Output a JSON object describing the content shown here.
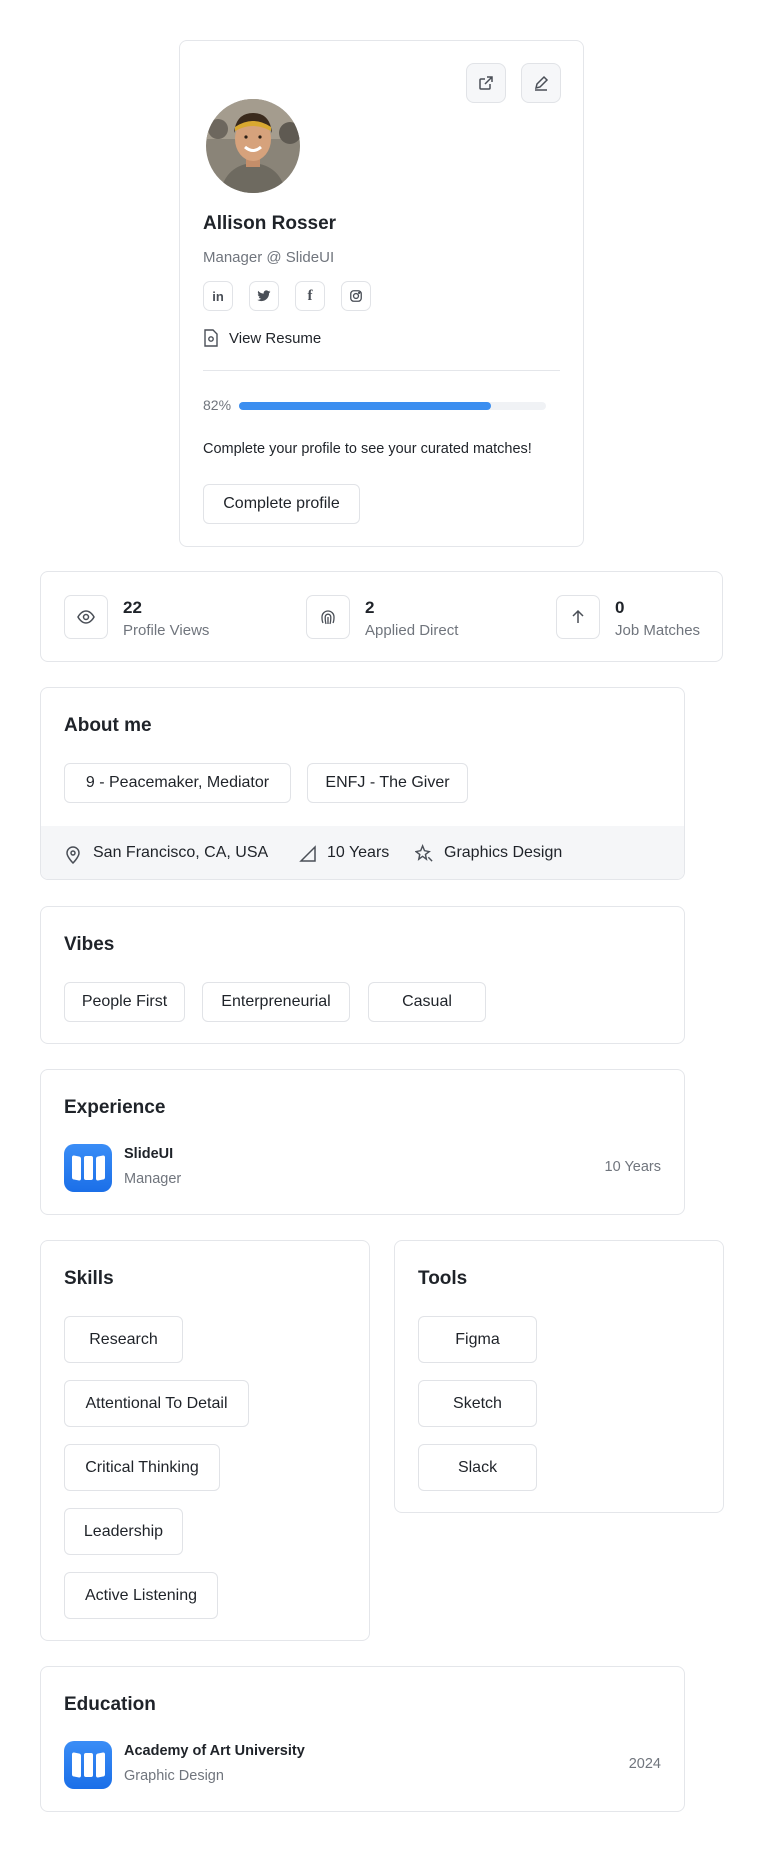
{
  "profile": {
    "name": "Allison Rosser",
    "role": "Manager @ SlideUI",
    "view_resume": "View Resume",
    "progress_label": "82%",
    "progress_value": 0.82,
    "complete_text": "Complete your profile to see your curated matches!",
    "complete_button": "Complete profile",
    "social_icons": [
      "linkedin-icon",
      "twitter-icon",
      "facebook-icon",
      "instagram-icon"
    ]
  },
  "stats": [
    {
      "value": "22",
      "label": "Profile Views",
      "icon": "eye-icon"
    },
    {
      "value": "2",
      "label": "Applied Direct",
      "icon": "fingerprint-icon"
    },
    {
      "value": "0",
      "label": "Job Matches",
      "icon": "arrow-up-icon"
    }
  ],
  "about": {
    "title": "About me",
    "chips": [
      "9 - Peacemaker, Mediator",
      "ENFJ - The Giver"
    ],
    "location": "San Francisco, CA, USA",
    "experience": "10 Years",
    "field": "Graphics Design"
  },
  "vibes": {
    "title": "Vibes",
    "chips": [
      "People First",
      "Enterpreneurial",
      "Casual"
    ]
  },
  "experience": {
    "title": "Experience",
    "company": "SlideUI",
    "role": "Manager",
    "duration": "10 Years"
  },
  "skills": {
    "title": "Skills",
    "chips": [
      "Research",
      "Attentional To Detail",
      "Critical Thinking",
      "Leadership",
      "Active Listening"
    ]
  },
  "tools": {
    "title": "Tools",
    "chips": [
      "Figma",
      "Sketch",
      "Slack"
    ]
  },
  "education": {
    "title": "Education",
    "school": "Academy of Art University",
    "degree": "Graphic Design",
    "year": "2024"
  },
  "colors": {
    "accent": "#3b8ef0",
    "track": "#f0f2f5",
    "logo": "#2a7ff0"
  }
}
